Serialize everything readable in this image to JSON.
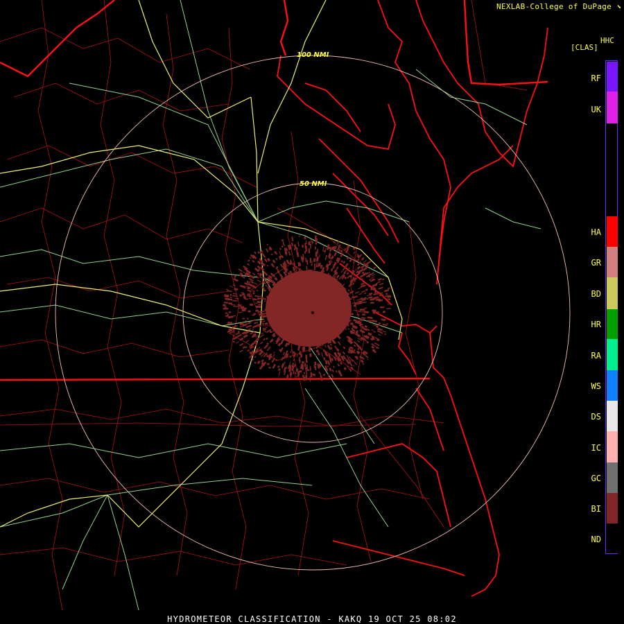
{
  "header": {
    "credit": "NEXLAB-College of DuPage",
    "product_code": "HHC",
    "product_sub": "[CLAS]"
  },
  "map": {
    "range_rings": [
      "50 NMI",
      "100 NMI"
    ],
    "colors": {
      "background": "#000000",
      "coastline_state": "#ff1010",
      "county": "#c01818",
      "highway": "#a8e8a0",
      "interstate": "#f0f070",
      "ring": "#f0c0b0",
      "echo": "#822626"
    }
  },
  "legend": {
    "classes": [
      {
        "code": "RF",
        "color": "#7a16ff"
      },
      {
        "code": "UK",
        "color": "#e020e8"
      },
      {
        "code": "HA",
        "color": "#ff0000"
      },
      {
        "code": "GR",
        "color": "#d08080"
      },
      {
        "code": "BD",
        "color": "#caca5a"
      },
      {
        "code": "HR",
        "color": "#00a000"
      },
      {
        "code": "RA",
        "color": "#00f090"
      },
      {
        "code": "WS",
        "color": "#1080ff"
      },
      {
        "code": "DS",
        "color": "#e8e8e8"
      },
      {
        "code": "IC",
        "color": "#ffb0b0"
      },
      {
        "code": "GC",
        "color": "#707070"
      },
      {
        "code": "BI",
        "color": "#822626"
      },
      {
        "code": "ND",
        "color": "#000000"
      }
    ]
  },
  "footer": {
    "title": "HYDROMETEOR CLASSIFICATION - KAKQ 19 OCT 25 08:02"
  }
}
